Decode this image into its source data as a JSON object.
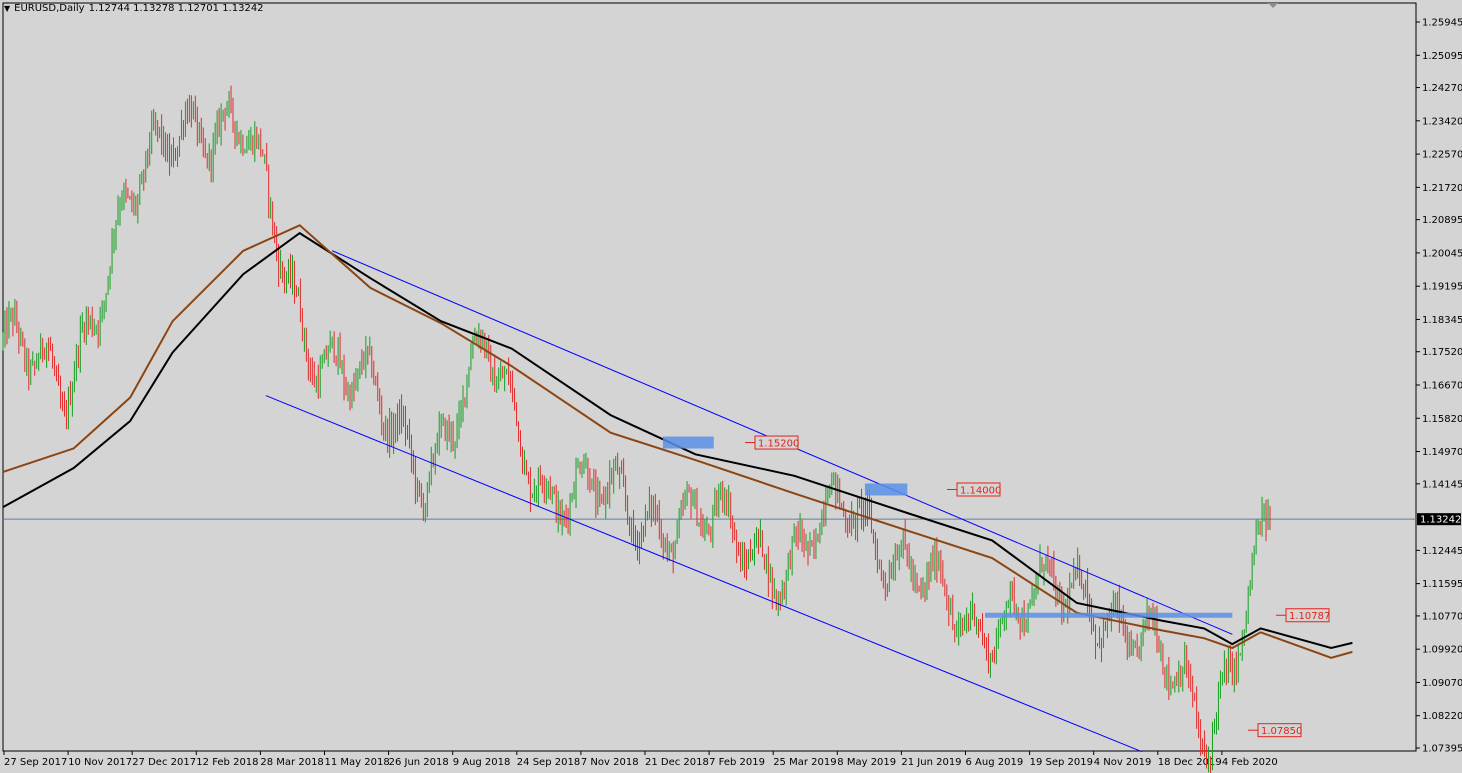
{
  "header": {
    "symbol_timeframe": "EURUSD,Daily",
    "ohlc": "1.12744 1.13278 1.12701 1.13242"
  },
  "price_axis": {
    "ticks": [
      "1.25945",
      "1.25095",
      "1.24270",
      "1.23420",
      "1.22570",
      "1.21720",
      "1.20895",
      "1.20045",
      "1.19195",
      "1.18345",
      "1.17520",
      "1.16670",
      "1.15820",
      "1.14970",
      "1.14145",
      "1.13242",
      "1.12445",
      "1.11595",
      "1.10770",
      "1.09920",
      "1.09070",
      "1.08220",
      "1.07395"
    ],
    "current_price": "1.13242"
  },
  "time_axis": {
    "ticks": [
      "27 Sep 2017",
      "10 Nov 2017",
      "27 Dec 2017",
      "12 Feb 2018",
      "28 Mar 2018",
      "11 May 2018",
      "26 Jun 2018",
      "9 Aug 2018",
      "24 Sep 2018",
      "7 Nov 2018",
      "21 Dec 2018",
      "7 Feb 2019",
      "25 Mar 2019",
      "8 May 2019",
      "21 Jun 2019",
      "6 Aug 2019",
      "19 Sep 2019",
      "4 Nov 2019",
      "18 Dec 2019",
      "4 Feb 2020"
    ]
  },
  "price_levels": [
    {
      "label": "1.15200",
      "price": 1.152
    },
    {
      "label": "1.14000",
      "price": 1.14
    },
    {
      "label": "1.10787",
      "price": 1.10787
    },
    {
      "label": "1.07850",
      "price": 1.0785
    }
  ],
  "chart_data": {
    "type": "candlestick",
    "symbol": "EURUSD",
    "timeframe": "Daily",
    "last_bar": {
      "open": 1.12744,
      "high": 1.13278,
      "low": 1.12701,
      "close": 1.13242
    },
    "ylim": [
      1.07,
      1.265
    ],
    "x_range": [
      "27 Sep 2017",
      "Feb 2020"
    ],
    "approx_close_path": [
      {
        "date": "27 Sep 2017",
        "close": 1.178
      },
      {
        "date": "10 Nov 2017",
        "close": 1.165
      },
      {
        "date": "27 Dec 2017",
        "close": 1.21
      },
      {
        "date": "12 Feb 2018",
        "close": 1.235
      },
      {
        "date": "28 Mar 2018",
        "close": 1.232
      },
      {
        "date": "11 May 2018",
        "close": 1.18
      },
      {
        "date": "26 Jun 2018",
        "close": 1.165
      },
      {
        "date": "9 Aug 2018",
        "close": 1.145
      },
      {
        "date": "24 Sep 2018",
        "close": 1.175
      },
      {
        "date": "7 Nov 2018",
        "close": 1.14
      },
      {
        "date": "21 Dec 2018",
        "close": 1.138
      },
      {
        "date": "7 Feb 2019",
        "close": 1.132
      },
      {
        "date": "25 Mar 2019",
        "close": 1.13
      },
      {
        "date": "8 May 2019",
        "close": 1.12
      },
      {
        "date": "21 Jun 2019",
        "close": 1.137
      },
      {
        "date": "6 Aug 2019",
        "close": 1.12
      },
      {
        "date": "19 Sep 2019",
        "close": 1.104
      },
      {
        "date": "4 Nov 2019",
        "close": 1.112
      },
      {
        "date": "18 Dec 2019",
        "close": 1.113
      },
      {
        "date": "4 Feb 2020",
        "close": 1.1
      },
      {
        "date": "20 Feb 2020",
        "close": 1.0785
      },
      {
        "date": "9 Mar 2020",
        "close": 1.1324
      }
    ],
    "moving_averages": [
      {
        "color": "#000000",
        "points": [
          [
            0,
            1.1355
          ],
          [
            0.05,
            1.1455
          ],
          [
            0.09,
            1.1575
          ],
          [
            0.12,
            1.175
          ],
          [
            0.17,
            1.195
          ],
          [
            0.21,
            1.2055
          ],
          [
            0.26,
            1.194
          ],
          [
            0.31,
            1.183
          ],
          [
            0.36,
            1.176
          ],
          [
            0.43,
            1.159
          ],
          [
            0.49,
            1.149
          ],
          [
            0.56,
            1.1435
          ],
          [
            0.64,
            1.134
          ],
          [
            0.7,
            1.127
          ],
          [
            0.76,
            1.111
          ],
          [
            0.82,
            1.1065
          ],
          [
            0.85,
            1.1045
          ],
          [
            0.87,
            1.1005
          ],
          [
            0.89,
            1.1045
          ],
          [
            0.94,
            1.0995
          ],
          [
            0.955,
            1.1008
          ]
        ]
      },
      {
        "color": "#8b4513",
        "points": [
          [
            0,
            1.1445
          ],
          [
            0.05,
            1.1505
          ],
          [
            0.09,
            1.1635
          ],
          [
            0.12,
            1.183
          ],
          [
            0.17,
            1.201
          ],
          [
            0.21,
            1.2075
          ],
          [
            0.26,
            1.1915
          ],
          [
            0.31,
            1.1825
          ],
          [
            0.36,
            1.1715
          ],
          [
            0.43,
            1.1545
          ],
          [
            0.49,
            1.1475
          ],
          [
            0.56,
            1.139
          ],
          [
            0.64,
            1.1295
          ],
          [
            0.7,
            1.1225
          ],
          [
            0.76,
            1.1085
          ],
          [
            0.82,
            1.104
          ],
          [
            0.85,
            1.102
          ],
          [
            0.87,
            1.0995
          ],
          [
            0.89,
            1.1035
          ],
          [
            0.94,
            1.097
          ],
          [
            0.955,
            1.0985
          ]
        ]
      }
    ],
    "channel_lines": [
      {
        "from": {
          "x": 0.233,
          "price": 1.201
        },
        "to": {
          "x": 0.87,
          "price": 1.103
        }
      },
      {
        "from": {
          "x": 0.186,
          "price": 1.164
        },
        "to": {
          "x": 0.806,
          "price": 1.073
        }
      }
    ],
    "support_zones": [
      {
        "price": 1.152,
        "x_from": 0.467,
        "x_to": 0.503
      },
      {
        "price": 1.14,
        "x_from": 0.61,
        "x_to": 0.64
      },
      {
        "price": 1.10787,
        "x_from": 0.695,
        "x_to": 0.87
      }
    ],
    "grid": false
  },
  "colors": {
    "background": "#d4d4d4",
    "bull_candle": "#169f23",
    "bear_candle": "#e22b2b",
    "channel": "#0000ff",
    "zone": "#5b8fe8",
    "level_text": "#e0241b",
    "current_price_line": "#5f7f9f"
  }
}
